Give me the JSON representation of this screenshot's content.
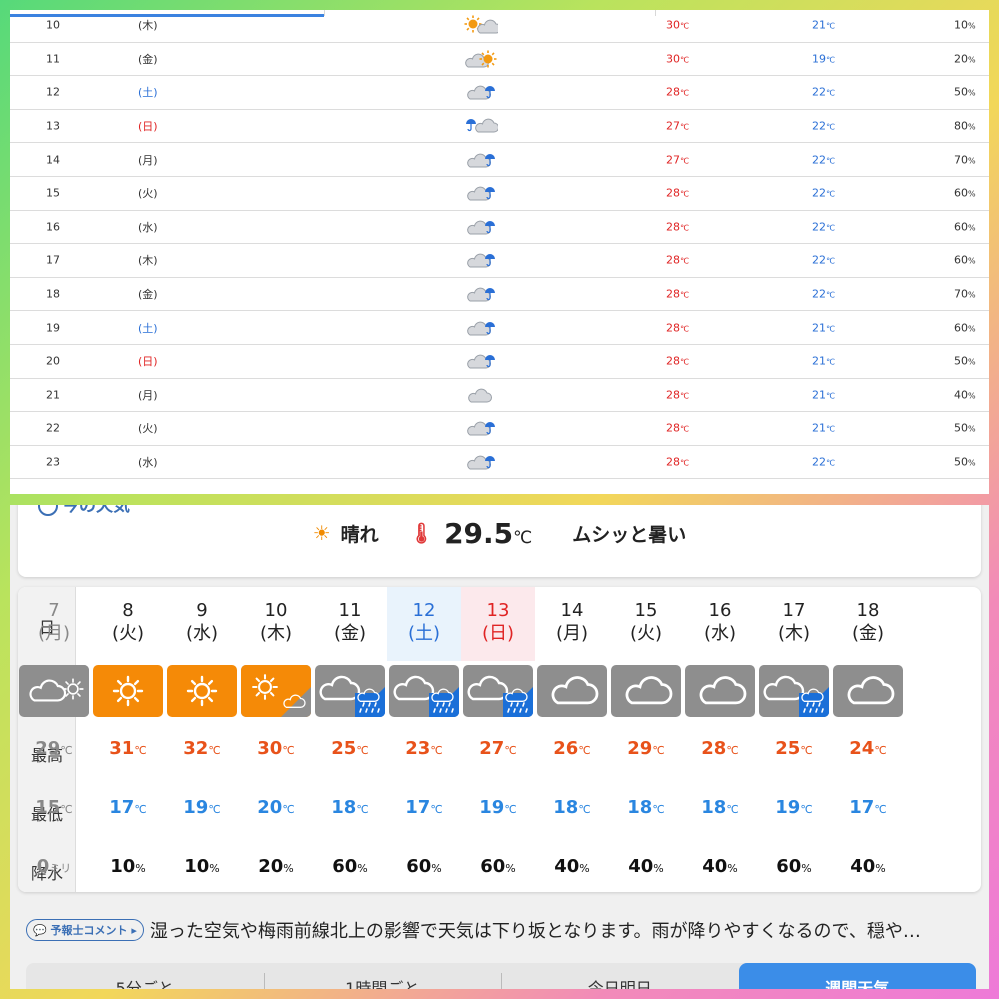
{
  "weekly_table": {
    "rows": [
      {
        "day": "10",
        "dow": "(木)",
        "dow_type": "normal",
        "icon": "sun-cloud-icon",
        "max": "30",
        "min": "21",
        "rain": "10"
      },
      {
        "day": "11",
        "dow": "(金)",
        "dow_type": "normal",
        "icon": "cloud-sun-icon",
        "max": "30",
        "min": "19",
        "rain": "20"
      },
      {
        "day": "12",
        "dow": "(土)",
        "dow_type": "sat",
        "icon": "cloud-rain-icon",
        "max": "28",
        "min": "22",
        "rain": "50"
      },
      {
        "day": "13",
        "dow": "(日)",
        "dow_type": "sun",
        "icon": "rain-cloud-icon",
        "max": "27",
        "min": "22",
        "rain": "80"
      },
      {
        "day": "14",
        "dow": "(月)",
        "dow_type": "normal",
        "icon": "cloud-rain-icon",
        "max": "27",
        "min": "22",
        "rain": "70"
      },
      {
        "day": "15",
        "dow": "(火)",
        "dow_type": "normal",
        "icon": "cloud-rain-icon",
        "max": "28",
        "min": "22",
        "rain": "60"
      },
      {
        "day": "16",
        "dow": "(水)",
        "dow_type": "normal",
        "icon": "cloud-rain-icon",
        "max": "28",
        "min": "22",
        "rain": "60"
      },
      {
        "day": "17",
        "dow": "(木)",
        "dow_type": "normal",
        "icon": "cloud-rain-icon",
        "max": "28",
        "min": "22",
        "rain": "60"
      },
      {
        "day": "18",
        "dow": "(金)",
        "dow_type": "normal",
        "icon": "cloud-rain-icon",
        "max": "28",
        "min": "22",
        "rain": "70"
      },
      {
        "day": "19",
        "dow": "(土)",
        "dow_type": "sat",
        "icon": "cloud-rain-icon",
        "max": "28",
        "min": "21",
        "rain": "60"
      },
      {
        "day": "20",
        "dow": "(日)",
        "dow_type": "sun",
        "icon": "cloud-rain-icon",
        "max": "28",
        "min": "21",
        "rain": "50"
      },
      {
        "day": "21",
        "dow": "(月)",
        "dow_type": "normal",
        "icon": "cloud-icon",
        "max": "28",
        "min": "21",
        "rain": "40"
      },
      {
        "day": "22",
        "dow": "(火)",
        "dow_type": "normal",
        "icon": "cloud-rain-icon",
        "max": "28",
        "min": "21",
        "rain": "50"
      },
      {
        "day": "23",
        "dow": "(水)",
        "dow_type": "normal",
        "icon": "cloud-rain-icon",
        "max": "28",
        "min": "22",
        "rain": "50"
      }
    ],
    "temp_unit": "℃",
    "rain_unit": "%"
  },
  "current": {
    "title_fragment": "今の天気",
    "weather": "晴れ",
    "temperature": "29.5",
    "temp_unit": "℃",
    "feeling": "ムシッと暑い"
  },
  "forecast": {
    "labels": {
      "day": "日",
      "weather": "天気",
      "max": "最高",
      "min": "最低",
      "rain": "降水"
    },
    "temp_unit": "℃",
    "days": [
      {
        "date": "7",
        "dow": "(月)",
        "type": "past",
        "weather": "cloud-sun",
        "max": "29",
        "min": "15",
        "rain": "0",
        "rain_unit": "ミリ"
      },
      {
        "date": "8",
        "dow": "(火)",
        "type": "normal",
        "weather": "sun",
        "max": "31",
        "min": "17",
        "rain": "10",
        "rain_unit": "%"
      },
      {
        "date": "9",
        "dow": "(水)",
        "type": "normal",
        "weather": "sun",
        "max": "32",
        "min": "19",
        "rain": "10",
        "rain_unit": "%"
      },
      {
        "date": "10",
        "dow": "(木)",
        "type": "normal",
        "weather": "sun-cloud",
        "max": "30",
        "min": "20",
        "rain": "20",
        "rain_unit": "%"
      },
      {
        "date": "11",
        "dow": "(金)",
        "type": "normal",
        "weather": "cloud-rain",
        "max": "25",
        "min": "18",
        "rain": "60",
        "rain_unit": "%"
      },
      {
        "date": "12",
        "dow": "(土)",
        "type": "sat",
        "weather": "cloud-rain",
        "max": "23",
        "min": "17",
        "rain": "60",
        "rain_unit": "%"
      },
      {
        "date": "13",
        "dow": "(日)",
        "type": "sun",
        "weather": "cloud-rain",
        "max": "27",
        "min": "19",
        "rain": "60",
        "rain_unit": "%"
      },
      {
        "date": "14",
        "dow": "(月)",
        "type": "normal",
        "weather": "cloud",
        "max": "26",
        "min": "18",
        "rain": "40",
        "rain_unit": "%"
      },
      {
        "date": "15",
        "dow": "(火)",
        "type": "normal",
        "weather": "cloud",
        "max": "29",
        "min": "18",
        "rain": "40",
        "rain_unit": "%"
      },
      {
        "date": "16",
        "dow": "(水)",
        "type": "normal",
        "weather": "cloud",
        "max": "28",
        "min": "18",
        "rain": "40",
        "rain_unit": "%"
      },
      {
        "date": "17",
        "dow": "(木)",
        "type": "normal",
        "weather": "cloud-rain",
        "max": "25",
        "min": "19",
        "rain": "60",
        "rain_unit": "%"
      },
      {
        "date": "18",
        "dow": "(金)",
        "type": "normal",
        "weather": "cloud",
        "max": "24",
        "min": "17",
        "rain": "40",
        "rain_unit": "%"
      }
    ]
  },
  "comment": {
    "badge": "予報士コメント",
    "text": "湿った空気や梅雨前線北上の影響で天気は下り坂となります。雨が降りやすくなるので、穏や…"
  },
  "tabs": [
    {
      "label": "5分ごと",
      "active": false
    },
    {
      "label": "1時間ごと",
      "active": false
    },
    {
      "label": "今日明日",
      "active": false
    },
    {
      "label": "週間天気",
      "active": true
    }
  ],
  "colors": {
    "accent_blue": "#3b8de8",
    "max_red": "#e8521a",
    "min_blue": "#2a86e0",
    "sunny_orange": "#f58a07",
    "cloudy_gray": "#8e8e8e"
  }
}
